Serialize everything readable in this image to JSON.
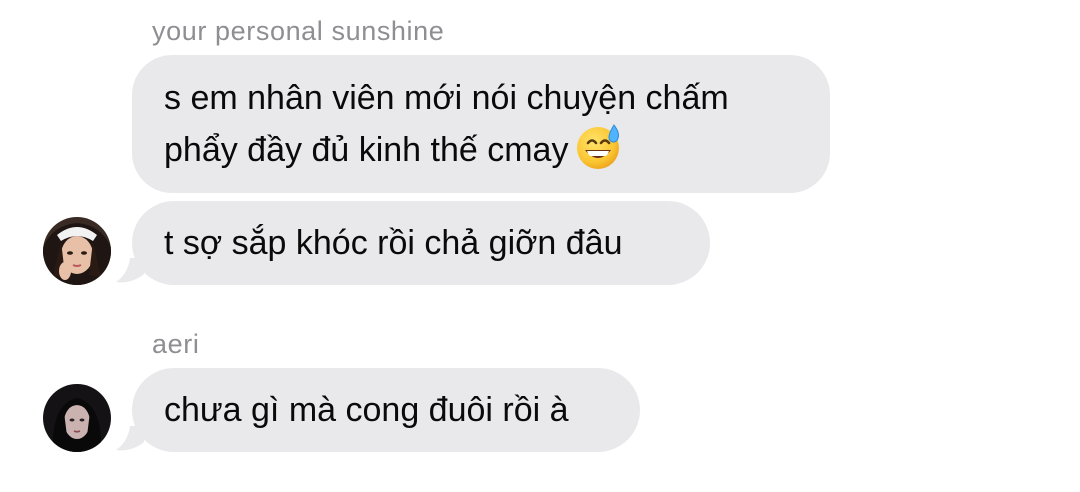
{
  "thread": {
    "groups": [
      {
        "sender": "your personal sunshine",
        "messages": [
          {
            "text": "s em nhân viên mới nói chuyện chấm\nphẩy đầy đủ kinh thế cmay",
            "emoji": "grinning-face-with-sweat-icon"
          },
          {
            "text": "t sợ sắp khóc rồi chả giỡn đâu"
          }
        ]
      },
      {
        "sender": "aeri",
        "messages": [
          {
            "text": "chưa gì mà cong đuôi rồi à"
          }
        ]
      }
    ]
  },
  "colors": {
    "bubble_background": "#e9e9eb",
    "sender_name": "#8e8e93",
    "message_text": "#0a0a0a",
    "page_background": "#ffffff"
  }
}
